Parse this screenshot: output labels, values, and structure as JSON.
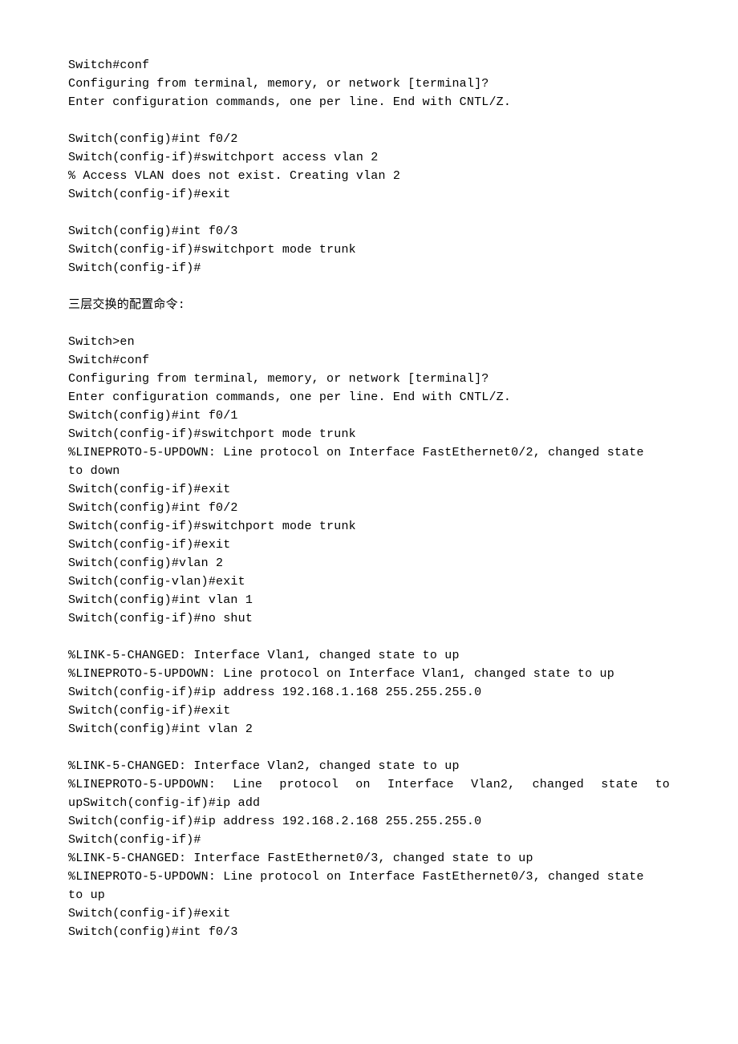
{
  "lines": [
    {
      "text": "Switch#conf"
    },
    {
      "text": "Configuring from terminal, memory, or network [terminal]?"
    },
    {
      "text": "Enter configuration commands, one per line. End with CNTL/Z."
    },
    {
      "blank": true
    },
    {
      "text": "Switch(config)#int f0/2"
    },
    {
      "text": "Switch(config-if)#switchport access vlan 2"
    },
    {
      "text": "% Access VLAN does not exist. Creating vlan 2"
    },
    {
      "text": "Switch(config-if)#exit"
    },
    {
      "blank": true
    },
    {
      "text": "Switch(config)#int f0/3"
    },
    {
      "text": "Switch(config-if)#switchport mode trunk"
    },
    {
      "text": "Switch(config-if)#"
    },
    {
      "blank": true
    },
    {
      "text": "三层交换的配置命令:"
    },
    {
      "blank": true
    },
    {
      "text": "Switch>en"
    },
    {
      "text": "Switch#conf"
    },
    {
      "text": "Configuring from terminal, memory, or network [terminal]?"
    },
    {
      "text": "Enter configuration commands, one per line. End with CNTL/Z."
    },
    {
      "text": "Switch(config)#int f0/1"
    },
    {
      "text": "Switch(config-if)#switchport mode trunk"
    },
    {
      "text": "%LINEPROTO-5-UPDOWN: Line protocol on Interface FastEthernet0/2, changed state"
    },
    {
      "text": "to down"
    },
    {
      "text": "Switch(config-if)#exit"
    },
    {
      "text": "Switch(config)#int f0/2"
    },
    {
      "text": "Switch(config-if)#switchport mode trunk"
    },
    {
      "text": "Switch(config-if)#exit"
    },
    {
      "text": "Switch(config)#vlan 2"
    },
    {
      "text": "Switch(config-vlan)#exit"
    },
    {
      "text": "Switch(config)#int vlan 1"
    },
    {
      "text": "Switch(config-if)#no shut"
    },
    {
      "blank": true
    },
    {
      "text": "%LINK-5-CHANGED: Interface Vlan1, changed state to up"
    },
    {
      "text": "%LINEPROTO-5-UPDOWN: Line protocol on Interface Vlan1, changed state to up"
    },
    {
      "text": "Switch(config-if)#ip address 192.168.1.168 255.255.255.0"
    },
    {
      "text": "Switch(config-if)#exit"
    },
    {
      "text": "Switch(config)#int vlan 2"
    },
    {
      "blank": true
    },
    {
      "text": "%LINK-5-CHANGED: Interface Vlan2, changed state to up"
    },
    {
      "text": "%LINEPROTO-5-UPDOWN: Line protocol on Interface Vlan2, changed state to",
      "justify": true
    },
    {
      "text": "upSwitch(config-if)#ip add"
    },
    {
      "text": "Switch(config-if)#ip address 192.168.2.168 255.255.255.0"
    },
    {
      "text": "Switch(config-if)#"
    },
    {
      "text": "%LINK-5-CHANGED: Interface FastEthernet0/3, changed state to up"
    },
    {
      "text": "%LINEPROTO-5-UPDOWN: Line protocol on Interface FastEthernet0/3, changed state"
    },
    {
      "text": "to up"
    },
    {
      "text": "Switch(config-if)#exit"
    },
    {
      "text": "Switch(config)#int f0/3"
    }
  ]
}
